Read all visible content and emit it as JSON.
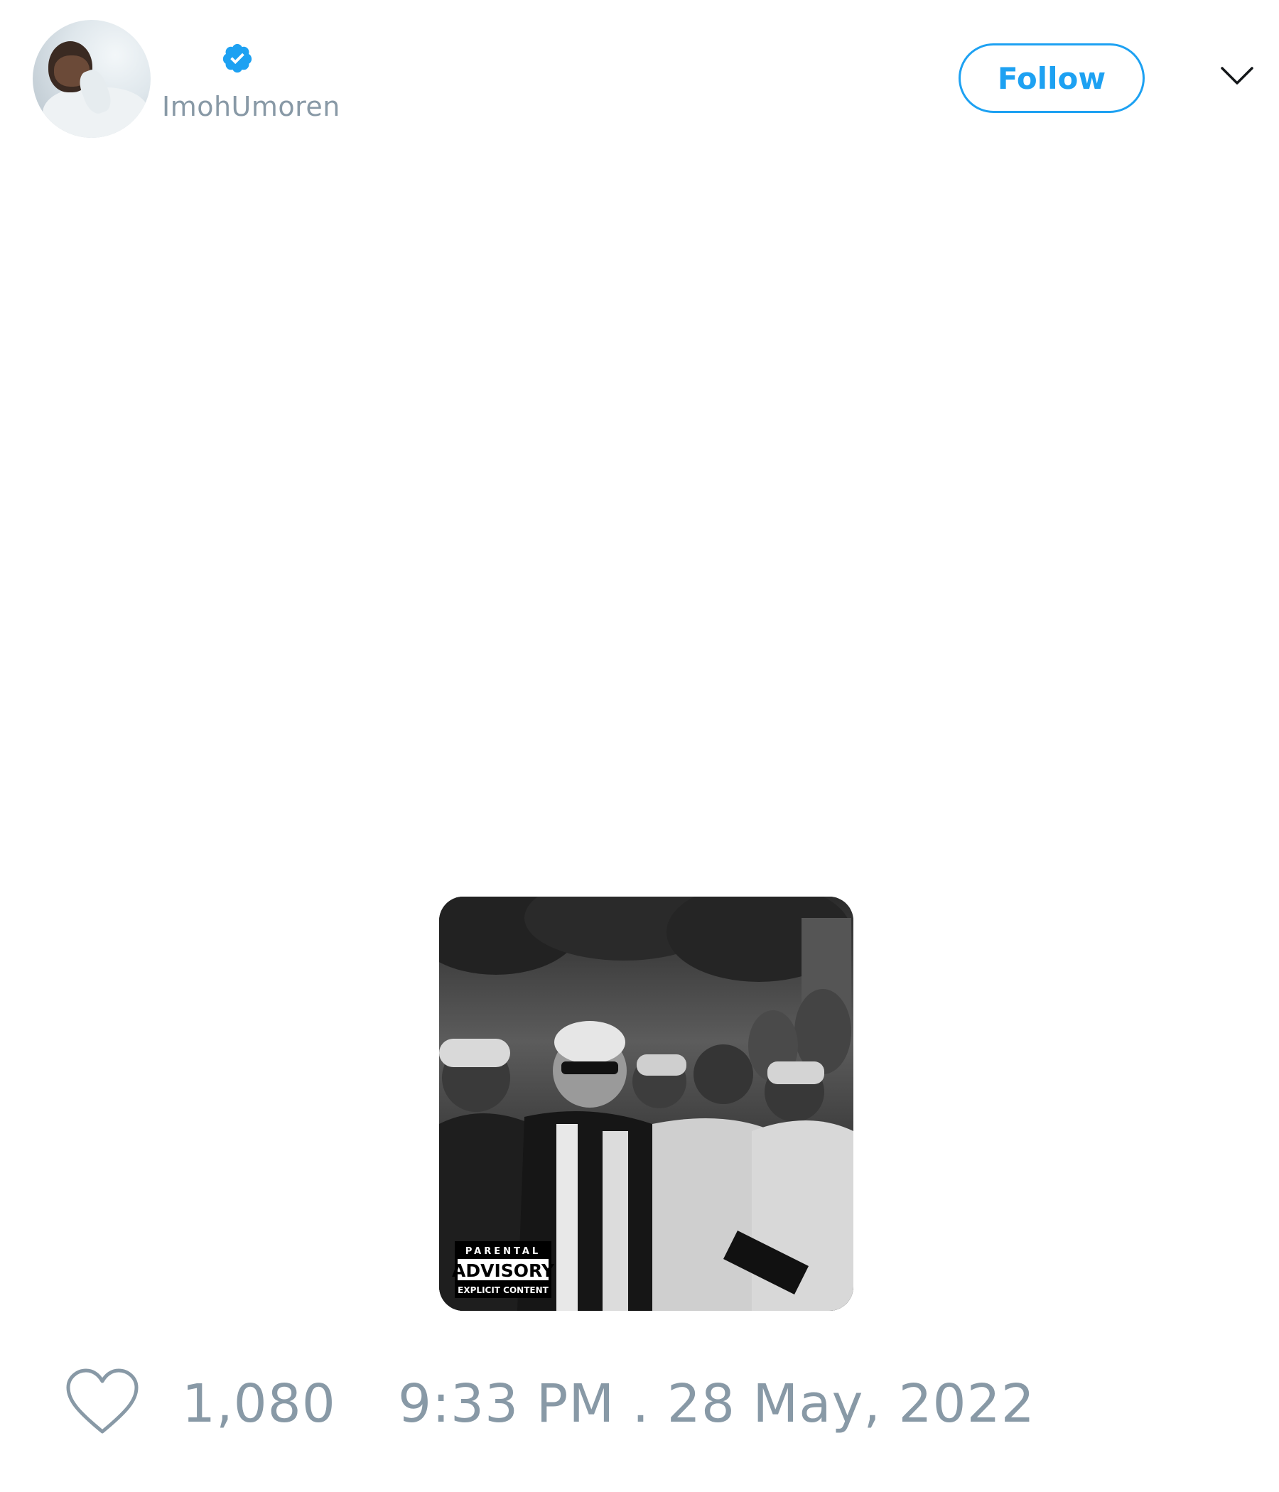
{
  "author": {
    "handle": "ImohUmoren",
    "verified": true,
    "avatar_icon": "profile-photo"
  },
  "header": {
    "follow_label": "Follow",
    "menu_icon": "chevron-down-icon"
  },
  "media": {
    "advisory_line1": "PARENTAL",
    "advisory_line2": "ADVISORY",
    "advisory_line3": "EXPLICIT CONTENT"
  },
  "footer": {
    "like_icon": "heart-icon",
    "like_count": "1,080",
    "timestamp": "9:33 PM . 28 May, 2022"
  },
  "colors": {
    "accent": "#1da1f2",
    "muted_text": "#8899a6"
  }
}
